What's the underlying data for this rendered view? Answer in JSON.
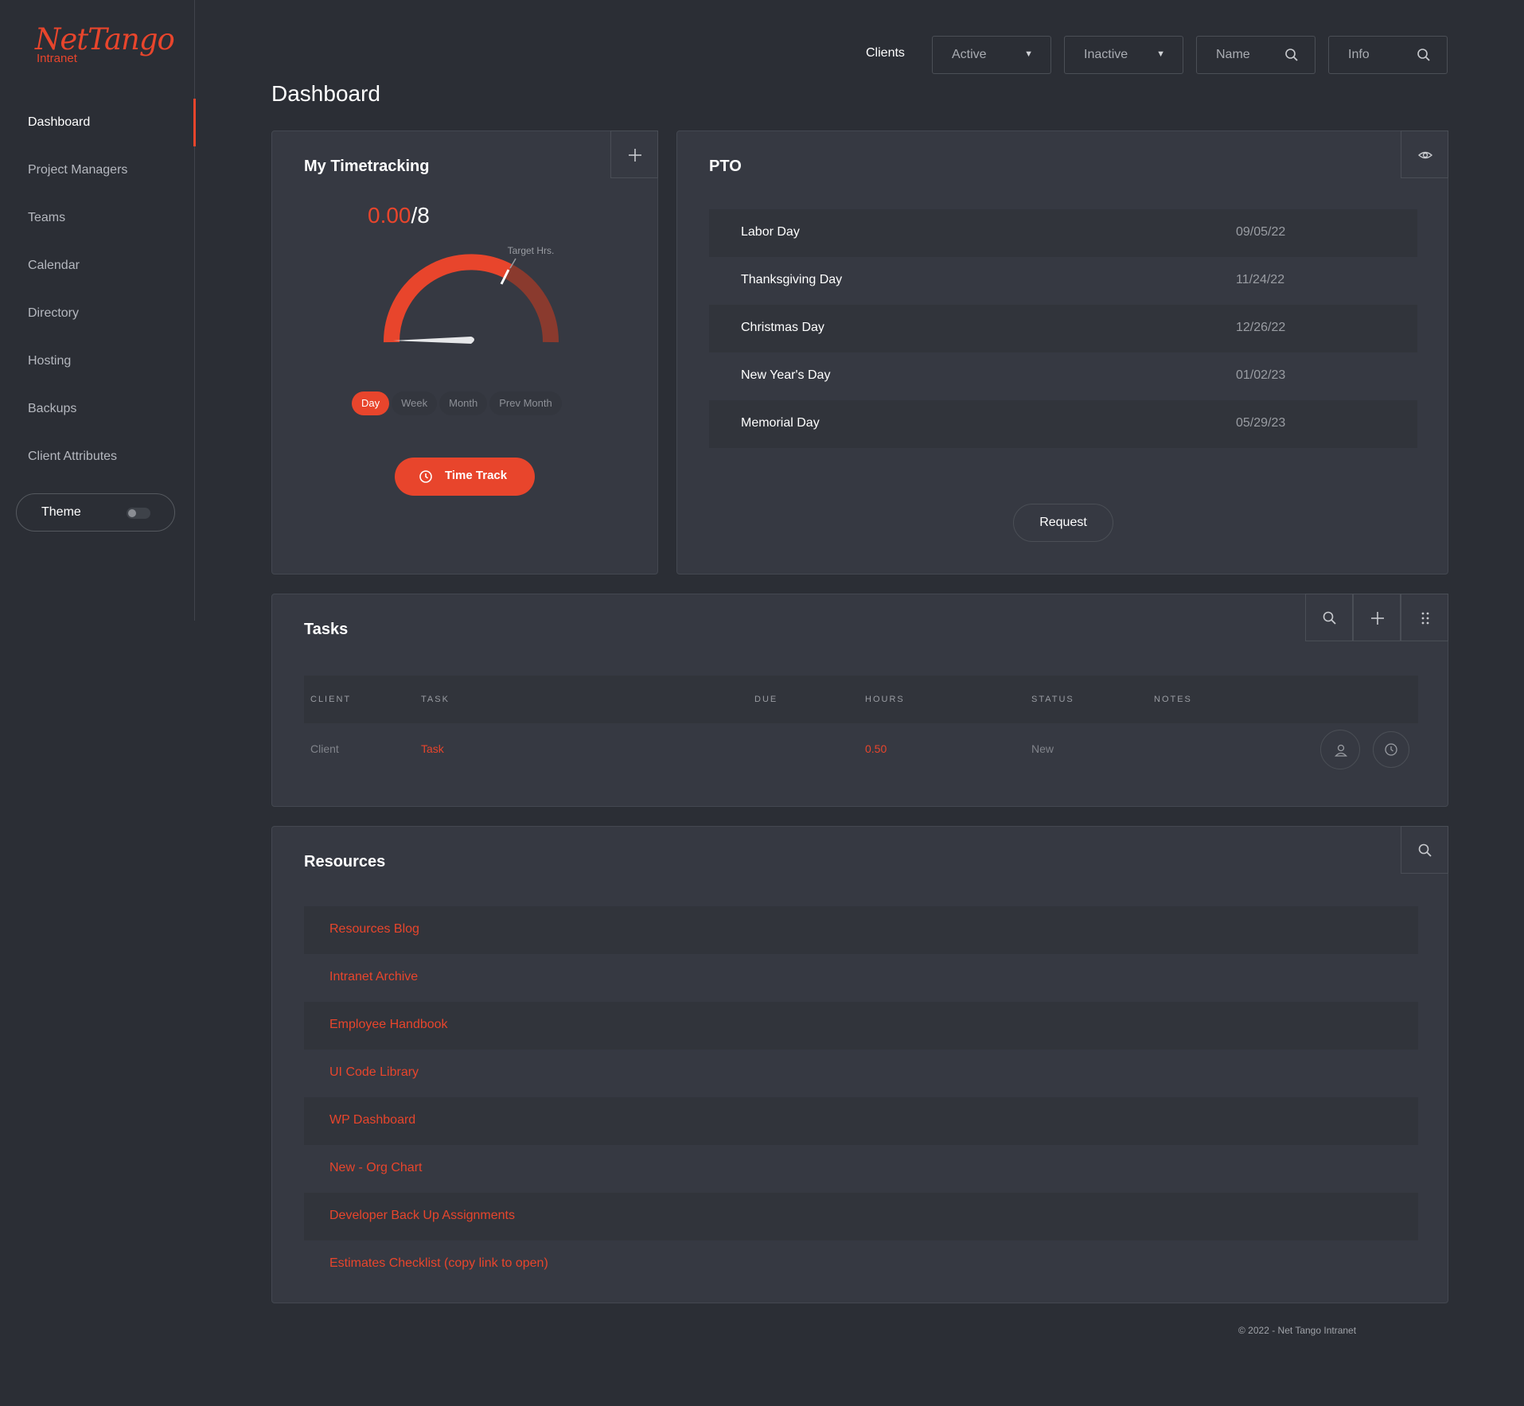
{
  "brand": {
    "name": "NetTango",
    "sub": "Intranet",
    "accent": "#e8452c"
  },
  "sidebar": {
    "items": [
      {
        "label": "Dashboard",
        "active": true
      },
      {
        "label": "Project Managers"
      },
      {
        "label": "Teams"
      },
      {
        "label": "Calendar"
      },
      {
        "label": "Directory"
      },
      {
        "label": "Hosting"
      },
      {
        "label": "Backups"
      },
      {
        "label": "Client Attributes"
      }
    ],
    "theme_label": "Theme"
  },
  "topbar": {
    "clients_label": "Clients",
    "active_select": "Active",
    "inactive_select": "Inactive",
    "name_search": "Name",
    "info_search": "Info"
  },
  "page_title": "Dashboard",
  "timetracking": {
    "title": "My Timetracking",
    "current": "0.00",
    "target": "/8",
    "target_label": "Target Hrs.",
    "progress_fraction": 0,
    "periods": [
      "Day",
      "Week",
      "Month",
      "Prev Month"
    ],
    "active_period": "Day",
    "button_label": "Time Track"
  },
  "pto": {
    "title": "PTO",
    "rows": [
      {
        "name": "Labor Day",
        "date": "09/05/22"
      },
      {
        "name": "Thanksgiving Day",
        "date": "11/24/22"
      },
      {
        "name": "Christmas Day",
        "date": "12/26/22"
      },
      {
        "name": "New Year's Day",
        "date": "01/02/23"
      },
      {
        "name": "Memorial Day",
        "date": "05/29/23"
      }
    ],
    "request_label": "Request"
  },
  "tasks": {
    "title": "Tasks",
    "columns": [
      "CLIENT",
      "TASK",
      "DUE",
      "HOURS",
      "STATUS",
      "NOTES"
    ],
    "rows": [
      {
        "client": "Client",
        "task": "Task",
        "due": "",
        "hours": "0.50",
        "status": "New",
        "notes": ""
      }
    ]
  },
  "resources": {
    "title": "Resources",
    "links": [
      "Resources Blog",
      "Intranet Archive",
      "Employee Handbook",
      "UI Code Library",
      "WP Dashboard",
      "New - Org Chart",
      "Developer Back Up Assignments",
      "Estimates Checklist (copy link to open)"
    ]
  },
  "footer": "© 2022 - Net Tango Intranet"
}
